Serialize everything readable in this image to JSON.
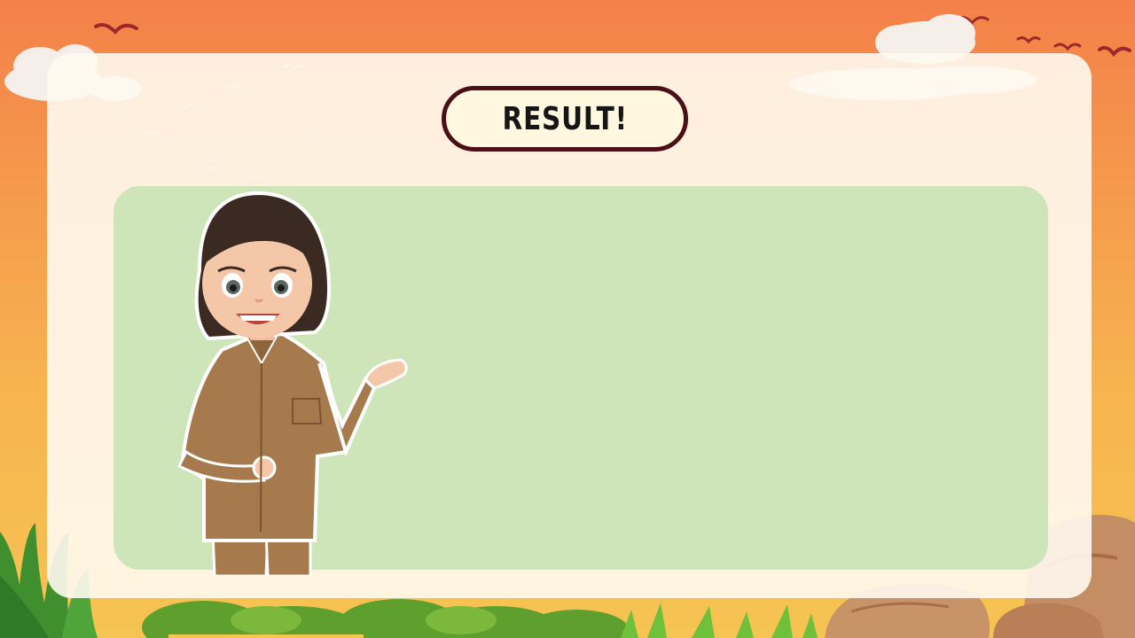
{
  "title": {
    "label": "RESULT!"
  },
  "colors": {
    "sky_top": "#f4804a",
    "sky_bottom": "#f6c453",
    "panel": "#fff9f0",
    "content_box": "#cde5b9",
    "title_border": "#4a0f17",
    "title_fill": "#fff7df"
  },
  "scene": {
    "icons": [
      "bird-icon",
      "cloud-icon",
      "grass-icon",
      "bush-icon",
      "rock-icon",
      "teacher-character-icon"
    ]
  }
}
